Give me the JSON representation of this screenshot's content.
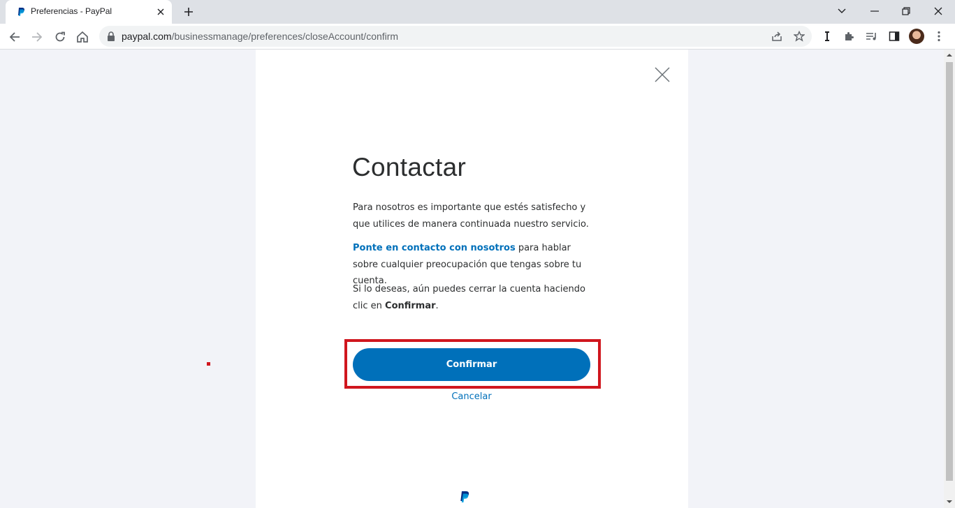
{
  "browser": {
    "tab_title": "Preferencias - PayPal",
    "url_host": "paypal.com",
    "url_path": "/businessmanage/preferences/closeAccount/confirm"
  },
  "dialog": {
    "heading": "Contactar",
    "para1": "Para nosotros es importante que estés satisfecho y que utilices de manera continuada nuestro servicio.",
    "para2_link": "Ponte en contacto con nosotros",
    "para2_rest": " para hablar sobre cualquier preocupación que tengas sobre tu cuenta.",
    "para3_pre": "Si lo deseas, aún puedes cerrar la cuenta haciendo clic en ",
    "para3_bold": "Confirmar",
    "para3_post": ".",
    "confirm_label": "Confirmar",
    "cancel_label": "Cancelar"
  },
  "colors": {
    "accent": "#0070ba",
    "highlight": "#d0161e"
  }
}
